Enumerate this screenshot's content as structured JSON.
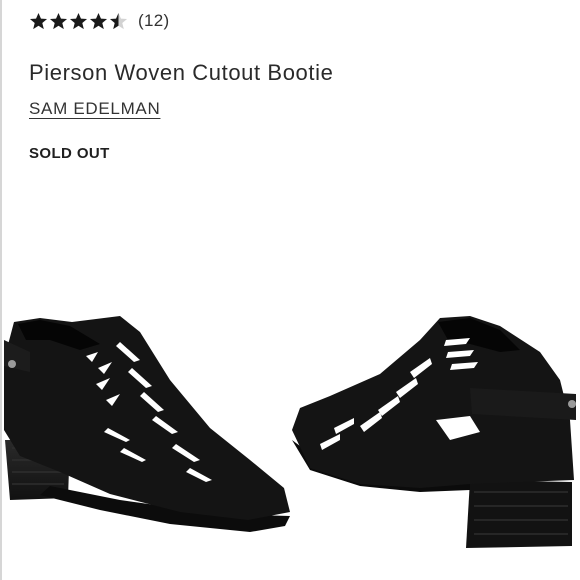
{
  "rating": {
    "stars_value": 4.5,
    "stars_max": 5,
    "review_count": "(12)"
  },
  "product": {
    "title": "Pierson Woven Cutout Bootie",
    "brand": "SAM EDELMAN",
    "availability": "SOLD OUT",
    "image_icon": "ankle-boots-photo"
  },
  "colors": {
    "star_filled": "#1a1a1a",
    "star_empty": "#d2d2d2",
    "boot": "#141414"
  }
}
